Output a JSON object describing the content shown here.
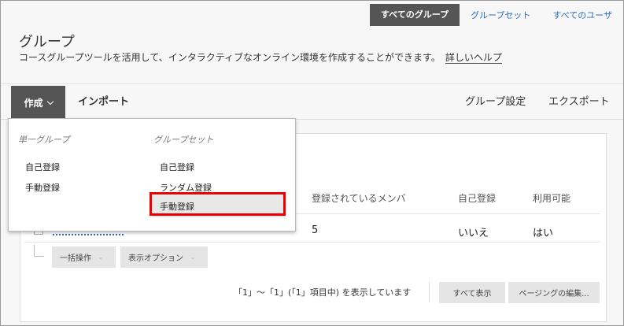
{
  "top_tabs": [
    "すべてのグループ",
    "グループセット",
    "すべてのユーザ"
  ],
  "page": {
    "title": "グループ",
    "description": "コースグループツールを活用して、インタラクティブなオンライン環境を作成することができます。",
    "help_link": "詳しいヘルプ"
  },
  "actions": {
    "create": "作成",
    "import": "インポート",
    "group_settings": "グループ設定",
    "export": "エクスポート"
  },
  "table": {
    "columns": [
      "登録されているメンバ",
      "自己登録",
      "利用可能"
    ],
    "row": {
      "members": "5",
      "self_enroll": "いいえ",
      "available": "はい"
    }
  },
  "bulk": {
    "bulk_actions": "一括操作",
    "display_options": "表示オプション"
  },
  "paging": {
    "status": "「1」～「1」(「1」項目中) を表示しています",
    "show_all": "すべて表示",
    "edit_paging": "ページングの編集..."
  },
  "dropdown": {
    "single_group": {
      "heading": "単一グループ",
      "items": [
        "自己登録",
        "手動登録"
      ]
    },
    "group_set": {
      "heading": "グループセット",
      "items": [
        "自己登録",
        "ランダム登録",
        "手動登録"
      ]
    }
  },
  "colors": {
    "highlight": "#e00000",
    "accent": "#555555",
    "link": "#2a6ebb"
  },
  "icons": [
    "chevron-down-icon",
    "corner-arrow-icon"
  ]
}
